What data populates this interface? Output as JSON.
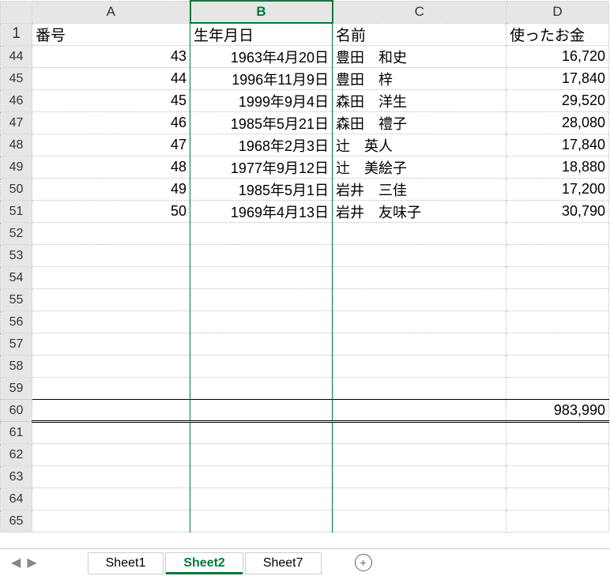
{
  "columns": {
    "a": "A",
    "b": "B",
    "c": "C",
    "d": "D"
  },
  "headers": {
    "a": "番号",
    "b": "生年月日",
    "c": "名前",
    "d": "使ったお金"
  },
  "rows": [
    {
      "rn": "44",
      "a": "43",
      "b": "1963年4月20日",
      "c": "豊田　和史",
      "d": "16,720"
    },
    {
      "rn": "45",
      "a": "44",
      "b": "1996年11月9日",
      "c": "豊田　梓",
      "d": "17,840"
    },
    {
      "rn": "46",
      "a": "45",
      "b": "1999年9月4日",
      "c": "森田　洋生",
      "d": "29,520"
    },
    {
      "rn": "47",
      "a": "46",
      "b": "1985年5月21日",
      "c": "森田　禮子",
      "d": "28,080"
    },
    {
      "rn": "48",
      "a": "47",
      "b": "1968年2月3日",
      "c": "辻　英人",
      "d": "17,840"
    },
    {
      "rn": "49",
      "a": "48",
      "b": "1977年9月12日",
      "c": "辻　美絵子",
      "d": "18,880"
    },
    {
      "rn": "50",
      "a": "49",
      "b": "1985年5月1日",
      "c": "岩井　三佳",
      "d": "17,200"
    },
    {
      "rn": "51",
      "a": "50",
      "b": "1969年4月13日",
      "c": "岩井　友味子",
      "d": "30,790"
    }
  ],
  "blank_rows": [
    "52",
    "53",
    "54",
    "55",
    "56",
    "57",
    "58",
    "59"
  ],
  "sum_row": {
    "rn": "60",
    "d": "983,990"
  },
  "after_rows": [
    "61",
    "62",
    "63",
    "64",
    "65"
  ],
  "sheets": {
    "s1": "Sheet1",
    "s2": "Sheet2",
    "s3": "Sheet7",
    "add": "+"
  },
  "nav": {
    "left": "◀",
    "right": "▶"
  }
}
